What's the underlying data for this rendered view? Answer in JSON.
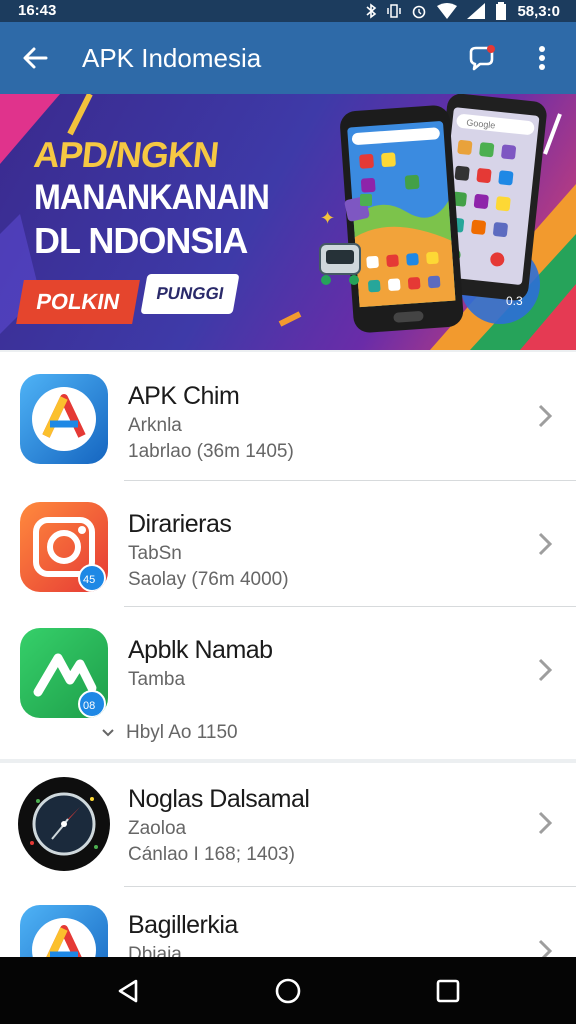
{
  "status_bar": {
    "time": "16:43",
    "right_text": "58,3:0",
    "icons": [
      "bluetooth-icon",
      "vibrate-icon",
      "alarm-icon",
      "wifi-icon",
      "signal-icon",
      "battery-icon"
    ]
  },
  "app_bar": {
    "title": "APK Indomesia",
    "back_icon": "arrow-left-icon",
    "chat_icon": "chat-bubble-icon",
    "more_icon": "more-vert-icon"
  },
  "banner": {
    "line1": "APD/NGKN",
    "line2": "MANANKANAIN",
    "line3": "DL NDONSIA",
    "badge_primary": "POLKIN",
    "badge_secondary": "PUNGGI",
    "corner_label": "0.3",
    "phone_search": "Google"
  },
  "apps": [
    {
      "name": "APK Chim",
      "category": "Arknla",
      "detail": "1abrlao (36m 1405)",
      "icon": "apk-store-icon"
    },
    {
      "name": "Dirarieras",
      "category": "TabSn",
      "detail": "Saolay (76m 4000)",
      "icon": "camera-app-icon",
      "badge": "45"
    },
    {
      "name": "Apblk Namab",
      "category": "Tamba",
      "detail": "",
      "icon": "green-app-icon",
      "badge": "08"
    },
    {
      "name": "Noglas Dalsamal",
      "category": "Zaoloa",
      "detail": "Cánlao I 168; 1403)",
      "icon": "compass-icon"
    },
    {
      "name": "Bagillerkia",
      "category": "Dbiaia",
      "detail": "",
      "icon": "apk-store-icon"
    }
  ],
  "expand_row": {
    "label": "Hbyl Ao 1150",
    "icon": "chevron-down-icon"
  },
  "colors": {
    "app_bar": "#2e6aa8",
    "status_bar": "#1c3c5e",
    "banner_yellow": "#f6c843",
    "badge_red": "#e5452d"
  },
  "nav_bar": {
    "icons": [
      "back-triangle-icon",
      "home-circle-icon",
      "recents-square-icon"
    ]
  }
}
